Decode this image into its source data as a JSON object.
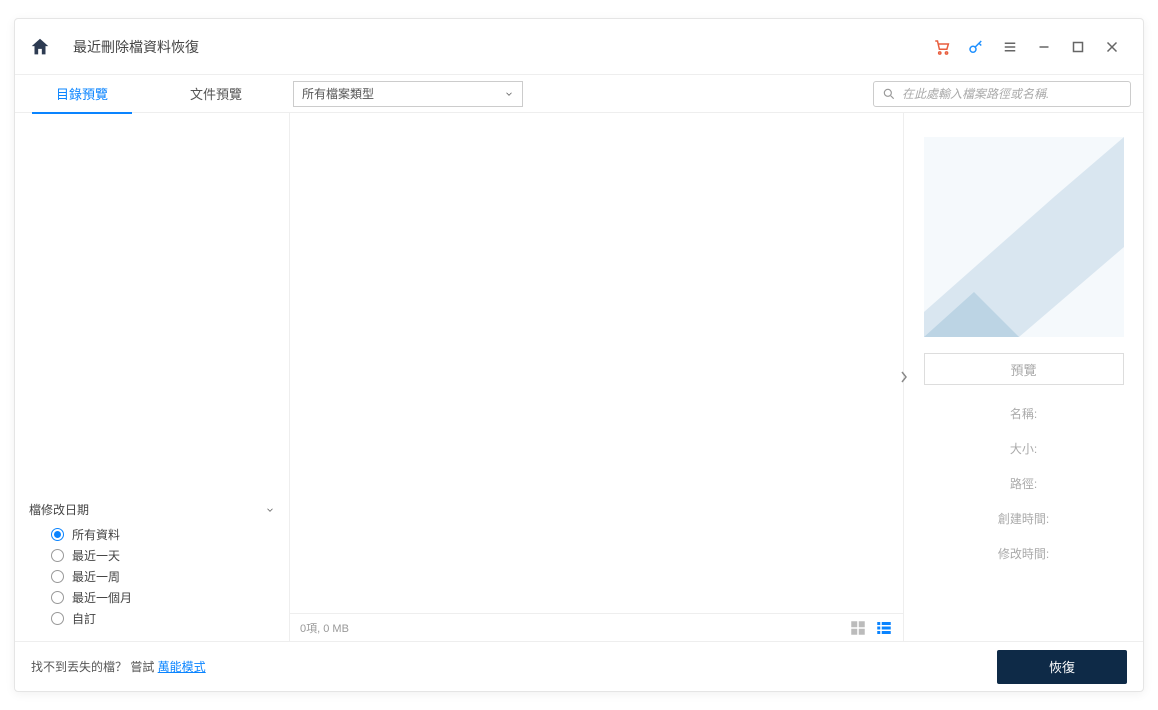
{
  "titlebar": {
    "title": "最近刪除檔資料恢復"
  },
  "tabs": {
    "directory": "目錄預覽",
    "file": "文件預覽"
  },
  "filetype_select": {
    "label": "所有檔案類型"
  },
  "search": {
    "placeholder": "在此處輸入檔案路徑或名稱."
  },
  "filter": {
    "heading": "檔修改日期",
    "options": [
      "所有資料",
      "最近一天",
      "最近一周",
      "最近一個月",
      "自訂"
    ],
    "selected_index": 0
  },
  "status": {
    "text": "0項, 0 MB"
  },
  "preview": {
    "button": "預覽",
    "labels": {
      "name": "名稱:",
      "size": "大小:",
      "path": "路徑:",
      "created": "創建時間:",
      "modified": "修改時間:"
    }
  },
  "footer": {
    "prompt": "找不到丟失的檔？ 嘗試 ",
    "link": "萬能模式",
    "recover": "恢復"
  }
}
